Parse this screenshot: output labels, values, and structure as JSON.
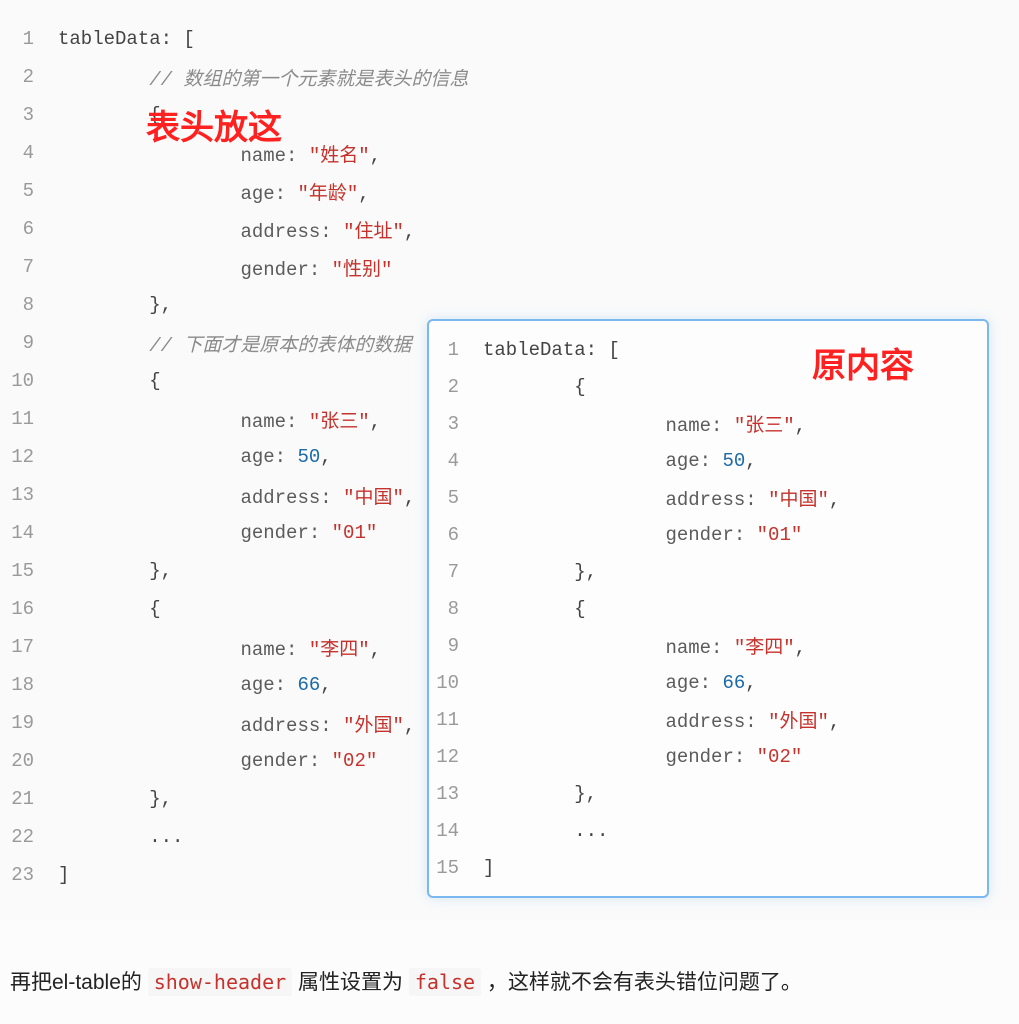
{
  "main_code": {
    "lines": [
      {
        "n": "1",
        "indent": 0,
        "tokens": [
          {
            "t": "tableData: [",
            "c": "tok-punct"
          }
        ]
      },
      {
        "n": "2",
        "indent": 2,
        "tokens": [
          {
            "t": "// 数组的第一个元素就是表头的信息",
            "c": "tok-comment"
          }
        ]
      },
      {
        "n": "3",
        "indent": 2,
        "tokens": [
          {
            "t": "{",
            "c": "tok-punct"
          }
        ]
      },
      {
        "n": "4",
        "indent": 4,
        "tokens": [
          {
            "t": "name: ",
            "c": "tok-key"
          },
          {
            "t": "\"姓名\"",
            "c": "tok-str"
          },
          {
            "t": ",",
            "c": "tok-punct"
          }
        ]
      },
      {
        "n": "5",
        "indent": 4,
        "tokens": [
          {
            "t": "age: ",
            "c": "tok-key"
          },
          {
            "t": "\"年龄\"",
            "c": "tok-str"
          },
          {
            "t": ",",
            "c": "tok-punct"
          }
        ]
      },
      {
        "n": "6",
        "indent": 4,
        "tokens": [
          {
            "t": "address: ",
            "c": "tok-key"
          },
          {
            "t": "\"住址\"",
            "c": "tok-str"
          },
          {
            "t": ",",
            "c": "tok-punct"
          }
        ]
      },
      {
        "n": "7",
        "indent": 4,
        "tokens": [
          {
            "t": "gender: ",
            "c": "tok-key"
          },
          {
            "t": "\"性别\"",
            "c": "tok-str"
          }
        ]
      },
      {
        "n": "8",
        "indent": 2,
        "tokens": [
          {
            "t": "},",
            "c": "tok-punct"
          }
        ]
      },
      {
        "n": "9",
        "indent": 2,
        "tokens": [
          {
            "t": "// 下面才是原本的表体的数据",
            "c": "tok-comment"
          }
        ]
      },
      {
        "n": "10",
        "indent": 2,
        "tokens": [
          {
            "t": "{",
            "c": "tok-punct"
          }
        ]
      },
      {
        "n": "11",
        "indent": 4,
        "tokens": [
          {
            "t": "name: ",
            "c": "tok-key"
          },
          {
            "t": "\"张三\"",
            "c": "tok-str"
          },
          {
            "t": ",",
            "c": "tok-punct"
          }
        ]
      },
      {
        "n": "12",
        "indent": 4,
        "tokens": [
          {
            "t": "age: ",
            "c": "tok-key"
          },
          {
            "t": "50",
            "c": "tok-num"
          },
          {
            "t": ",",
            "c": "tok-punct"
          }
        ]
      },
      {
        "n": "13",
        "indent": 4,
        "tokens": [
          {
            "t": "address: ",
            "c": "tok-key"
          },
          {
            "t": "\"中国\"",
            "c": "tok-str"
          },
          {
            "t": ",",
            "c": "tok-punct"
          }
        ]
      },
      {
        "n": "14",
        "indent": 4,
        "tokens": [
          {
            "t": "gender: ",
            "c": "tok-key"
          },
          {
            "t": "\"01\"",
            "c": "tok-str"
          }
        ]
      },
      {
        "n": "15",
        "indent": 2,
        "tokens": [
          {
            "t": "},",
            "c": "tok-punct"
          }
        ]
      },
      {
        "n": "16",
        "indent": 2,
        "tokens": [
          {
            "t": "{",
            "c": "tok-punct"
          }
        ]
      },
      {
        "n": "17",
        "indent": 4,
        "tokens": [
          {
            "t": "name: ",
            "c": "tok-key"
          },
          {
            "t": "\"李四\"",
            "c": "tok-str"
          },
          {
            "t": ",",
            "c": "tok-punct"
          }
        ]
      },
      {
        "n": "18",
        "indent": 4,
        "tokens": [
          {
            "t": "age: ",
            "c": "tok-key"
          },
          {
            "t": "66",
            "c": "tok-num"
          },
          {
            "t": ",",
            "c": "tok-punct"
          }
        ]
      },
      {
        "n": "19",
        "indent": 4,
        "tokens": [
          {
            "t": "address: ",
            "c": "tok-key"
          },
          {
            "t": "\"外国\"",
            "c": "tok-str"
          },
          {
            "t": ",",
            "c": "tok-punct"
          }
        ]
      },
      {
        "n": "20",
        "indent": 4,
        "tokens": [
          {
            "t": "gender: ",
            "c": "tok-key"
          },
          {
            "t": "\"02\"",
            "c": "tok-str"
          }
        ]
      },
      {
        "n": "21",
        "indent": 2,
        "tokens": [
          {
            "t": "},",
            "c": "tok-punct"
          }
        ]
      },
      {
        "n": "22",
        "indent": 2,
        "tokens": [
          {
            "t": "...",
            "c": "tok-punct"
          }
        ]
      },
      {
        "n": "23",
        "indent": 0,
        "tokens": [
          {
            "t": "]",
            "c": "tok-punct"
          }
        ]
      }
    ]
  },
  "inset_code": {
    "lines": [
      {
        "n": "1",
        "indent": 0,
        "tokens": [
          {
            "t": "tableData: [",
            "c": "tok-punct"
          }
        ]
      },
      {
        "n": "2",
        "indent": 2,
        "tokens": [
          {
            "t": "{",
            "c": "tok-punct"
          }
        ]
      },
      {
        "n": "3",
        "indent": 4,
        "tokens": [
          {
            "t": "name: ",
            "c": "tok-key"
          },
          {
            "t": "\"张三\"",
            "c": "tok-str"
          },
          {
            "t": ",",
            "c": "tok-punct"
          }
        ]
      },
      {
        "n": "4",
        "indent": 4,
        "tokens": [
          {
            "t": "age: ",
            "c": "tok-key"
          },
          {
            "t": "50",
            "c": "tok-num"
          },
          {
            "t": ",",
            "c": "tok-punct"
          }
        ]
      },
      {
        "n": "5",
        "indent": 4,
        "tokens": [
          {
            "t": "address: ",
            "c": "tok-key"
          },
          {
            "t": "\"中国\"",
            "c": "tok-str"
          },
          {
            "t": ",",
            "c": "tok-punct"
          }
        ]
      },
      {
        "n": "6",
        "indent": 4,
        "tokens": [
          {
            "t": "gender: ",
            "c": "tok-key"
          },
          {
            "t": "\"01\"",
            "c": "tok-str"
          }
        ]
      },
      {
        "n": "7",
        "indent": 2,
        "tokens": [
          {
            "t": "},",
            "c": "tok-punct"
          }
        ]
      },
      {
        "n": "8",
        "indent": 2,
        "tokens": [
          {
            "t": "{",
            "c": "tok-punct"
          }
        ]
      },
      {
        "n": "9",
        "indent": 4,
        "tokens": [
          {
            "t": "name: ",
            "c": "tok-key"
          },
          {
            "t": "\"李四\"",
            "c": "tok-str"
          },
          {
            "t": ",",
            "c": "tok-punct"
          }
        ]
      },
      {
        "n": "10",
        "indent": 4,
        "tokens": [
          {
            "t": "age: ",
            "c": "tok-key"
          },
          {
            "t": "66",
            "c": "tok-num"
          },
          {
            "t": ",",
            "c": "tok-punct"
          }
        ]
      },
      {
        "n": "11",
        "indent": 4,
        "tokens": [
          {
            "t": "address: ",
            "c": "tok-key"
          },
          {
            "t": "\"外国\"",
            "c": "tok-str"
          },
          {
            "t": ",",
            "c": "tok-punct"
          }
        ]
      },
      {
        "n": "12",
        "indent": 4,
        "tokens": [
          {
            "t": "gender: ",
            "c": "tok-key"
          },
          {
            "t": "\"02\"",
            "c": "tok-str"
          }
        ]
      },
      {
        "n": "13",
        "indent": 2,
        "tokens": [
          {
            "t": "},",
            "c": "tok-punct"
          }
        ]
      },
      {
        "n": "14",
        "indent": 2,
        "tokens": [
          {
            "t": "...",
            "c": "tok-punct"
          }
        ]
      },
      {
        "n": "15",
        "indent": 0,
        "tokens": [
          {
            "t": "]",
            "c": "tok-punct"
          }
        ]
      }
    ]
  },
  "annotations": {
    "a1": "表头放这",
    "a2": "原内容"
  },
  "footer": {
    "part1": "再把el-table的 ",
    "code1": "show-header",
    "part2": " 属性设置为 ",
    "code2": "false",
    "part3": " ，这样就不会有表头错位问题了。"
  }
}
